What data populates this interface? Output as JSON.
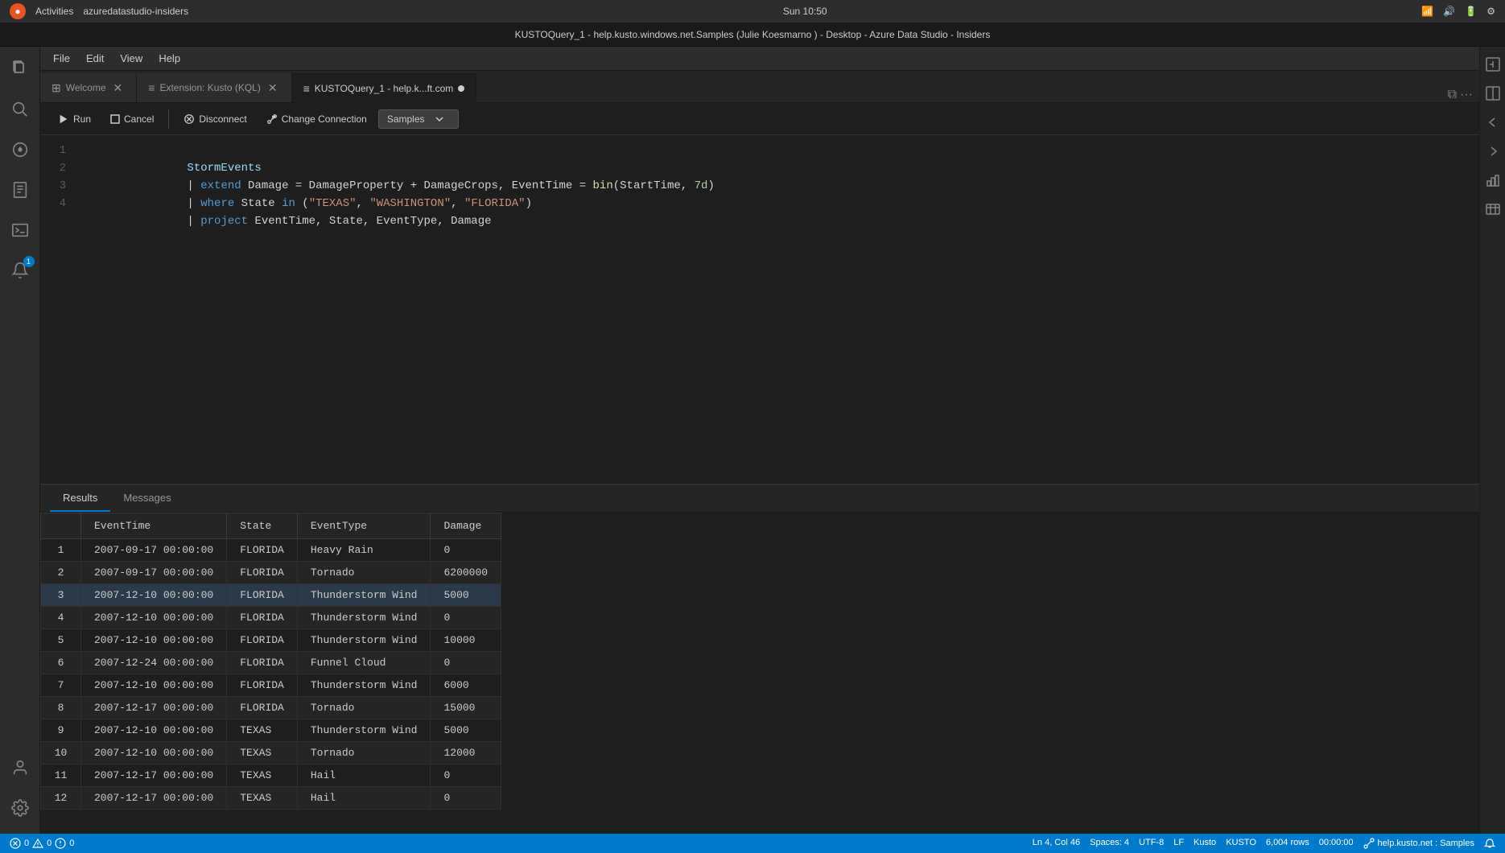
{
  "topbar": {
    "title": "Sun 10:50",
    "activities": "Activities",
    "app": "azuredatastudio-insiders"
  },
  "titlebar": {
    "title": "KUSTOQuery_1 - help.kusto.windows.net.Samples (Julie Koesmarno        ) - Desktop - Azure Data Studio - Insiders"
  },
  "menu": {
    "items": [
      "File",
      "Edit",
      "View",
      "Help"
    ]
  },
  "tabs": [
    {
      "id": "welcome",
      "label": "Welcome",
      "icon": "⊞",
      "active": false
    },
    {
      "id": "extension",
      "label": "Extension: Kusto (KQL)",
      "icon": "≡",
      "active": false
    },
    {
      "id": "query",
      "label": "KUSTOQuery_1 - help.k...ft.com",
      "icon": "≡",
      "active": true,
      "dirty": true
    }
  ],
  "toolbar": {
    "run_label": "Run",
    "cancel_label": "Cancel",
    "disconnect_label": "Disconnect",
    "change_connection_label": "Change Connection",
    "database": "Samples"
  },
  "code": {
    "lines": [
      {
        "num": "1",
        "content": "StormEvents"
      },
      {
        "num": "2",
        "content": "| extend Damage = DamageProperty + DamageCrops, EventTime = bin(StartTime, 7d)"
      },
      {
        "num": "3",
        "content": "| where State in (\"TEXAS\", \"WASHINGTON\", \"FLORIDA\")"
      },
      {
        "num": "4",
        "content": "| project EventTime, State, EventType, Damage"
      }
    ]
  },
  "results": {
    "tabs": [
      {
        "id": "results",
        "label": "Results",
        "active": true
      },
      {
        "id": "messages",
        "label": "Messages",
        "active": false
      }
    ],
    "columns": [
      "EventTime",
      "State",
      "EventType",
      "Damage"
    ],
    "rows": [
      {
        "num": "1",
        "EventTime": "2007-09-17 00:00:00",
        "State": "FLORIDA",
        "EventType": "Heavy Rain",
        "Damage": "0"
      },
      {
        "num": "2",
        "EventTime": "2007-09-17 00:00:00",
        "State": "FLORIDA",
        "EventType": "Tornado",
        "Damage": "6200000"
      },
      {
        "num": "3",
        "EventTime": "2007-12-10 00:00:00",
        "State": "FLORIDA",
        "EventType": "Thunderstorm Wind",
        "Damage": "5000",
        "selected": true
      },
      {
        "num": "4",
        "EventTime": "2007-12-10 00:00:00",
        "State": "FLORIDA",
        "EventType": "Thunderstorm Wind",
        "Damage": "0"
      },
      {
        "num": "5",
        "EventTime": "2007-12-10 00:00:00",
        "State": "FLORIDA",
        "EventType": "Thunderstorm Wind",
        "Damage": "10000"
      },
      {
        "num": "6",
        "EventTime": "2007-12-24 00:00:00",
        "State": "FLORIDA",
        "EventType": "Funnel Cloud",
        "Damage": "0"
      },
      {
        "num": "7",
        "EventTime": "2007-12-10 00:00:00",
        "State": "FLORIDA",
        "EventType": "Thunderstorm Wind",
        "Damage": "6000"
      },
      {
        "num": "8",
        "EventTime": "2007-12-17 00:00:00",
        "State": "FLORIDA",
        "EventType": "Tornado",
        "Damage": "15000"
      },
      {
        "num": "9",
        "EventTime": "2007-12-10 00:00:00",
        "State": "TEXAS",
        "EventType": "Thunderstorm Wind",
        "Damage": "5000"
      },
      {
        "num": "10",
        "EventTime": "2007-12-10 00:00:00",
        "State": "TEXAS",
        "EventType": "Tornado",
        "Damage": "12000"
      },
      {
        "num": "11",
        "EventTime": "2007-12-17 00:00:00",
        "State": "TEXAS",
        "EventType": "Hail",
        "Damage": "0"
      },
      {
        "num": "12",
        "EventTime": "2007-12-17 00:00:00",
        "State": "TEXAS",
        "EventType": "Hail",
        "Damage": "0"
      }
    ]
  },
  "statusbar": {
    "errors": "0",
    "warnings": "0",
    "info": "0",
    "ln": "Ln 4, Col 46",
    "spaces": "Spaces: 4",
    "encoding": "UTF-8",
    "eol": "LF",
    "language": "Kusto",
    "mode": "KUSTO",
    "rows": "6,004 rows",
    "time": "00:00:00",
    "connection": "help.kusto.net : Samples"
  },
  "activity_icons": [
    {
      "id": "files",
      "symbol": "⧉",
      "active": false
    },
    {
      "id": "search",
      "symbol": "🔍",
      "active": false
    },
    {
      "id": "info",
      "symbol": "ℹ",
      "active": false
    },
    {
      "id": "notebook",
      "symbol": "📓",
      "active": false
    },
    {
      "id": "terminal",
      "symbol": "⬛",
      "active": false
    },
    {
      "id": "notification",
      "symbol": "🔔",
      "badge": "1",
      "active": false
    },
    {
      "id": "account",
      "symbol": "◉",
      "active": false
    }
  ],
  "right_icons": [
    {
      "id": "chart-toggle",
      "symbol": "⊞"
    },
    {
      "id": "view-split",
      "symbol": "◫"
    },
    {
      "id": "view-more",
      "symbol": "≡"
    },
    {
      "id": "bar-chart",
      "symbol": "📊"
    },
    {
      "id": "table-view",
      "symbol": "⊞"
    }
  ]
}
